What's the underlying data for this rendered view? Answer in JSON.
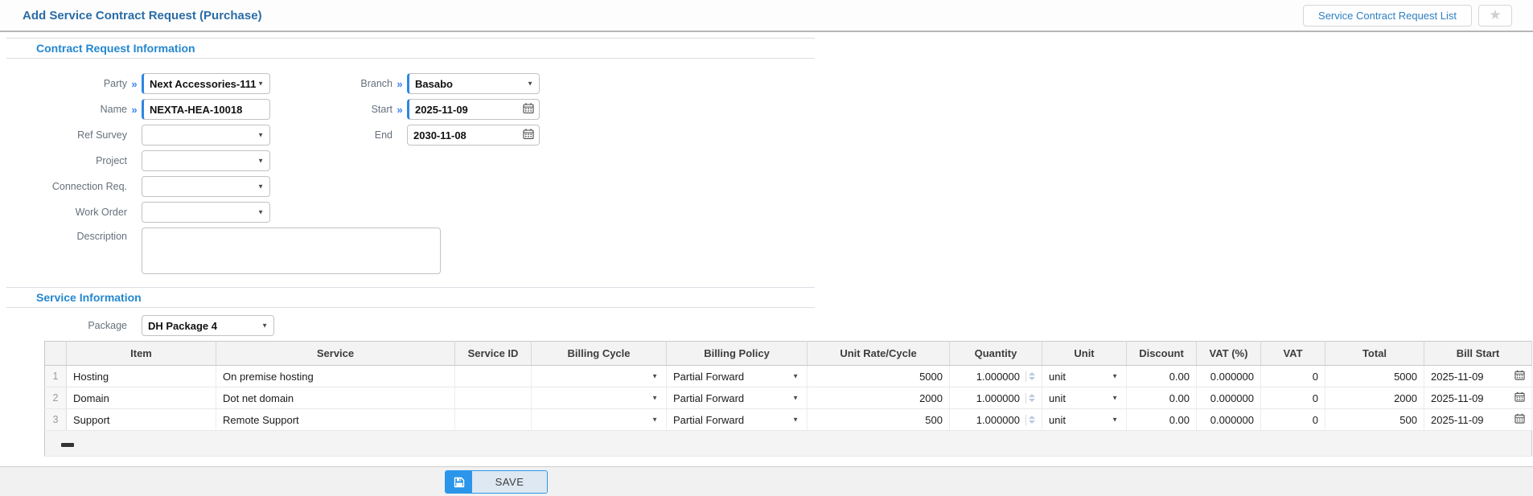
{
  "header": {
    "title": "Add Service Contract Request (Purchase)",
    "list_button_label": "Service Contract Request List"
  },
  "icons": {
    "caret": "▼",
    "required_marker": "»",
    "star": "★"
  },
  "contract_section": {
    "title": "Contract Request Information",
    "fields": {
      "party": {
        "label": "Party",
        "value": "Next Accessories-111"
      },
      "name": {
        "label": "Name",
        "value": "NEXTA-HEA-10018"
      },
      "ref_survey": {
        "label": "Ref Survey",
        "value": ""
      },
      "project": {
        "label": "Project",
        "value": ""
      },
      "connection_req": {
        "label": "Connection Req.",
        "value": ""
      },
      "work_order": {
        "label": "Work Order",
        "value": ""
      },
      "description": {
        "label": "Description",
        "value": ""
      },
      "branch": {
        "label": "Branch",
        "value": "Basabo"
      },
      "start": {
        "label": "Start",
        "value": "2025-11-09"
      },
      "end": {
        "label": "End",
        "value": "2030-11-08"
      }
    }
  },
  "service_section": {
    "title": "Service Information",
    "package": {
      "label": "Package",
      "value": "DH Package 4"
    }
  },
  "table": {
    "columns": [
      "",
      "Item",
      "Service",
      "Service ID",
      "Billing Cycle",
      "Billing Policy",
      "Unit Rate/Cycle",
      "Quantity",
      "Unit",
      "Discount",
      "VAT (%)",
      "VAT",
      "Total",
      "Bill Start"
    ],
    "rows": [
      {
        "no": "1",
        "item": "Hosting",
        "service": "On premise hosting",
        "service_id": "",
        "billing_cycle": "",
        "billing_policy": "Partial Forward",
        "unit_rate": "5000",
        "quantity": "1.000000",
        "unit": "unit",
        "discount": "0.00",
        "vat_pct": "0.000000",
        "vat": "0",
        "total": "5000",
        "bill_start": "2025-11-09"
      },
      {
        "no": "2",
        "item": "Domain",
        "service": "Dot net domain",
        "service_id": "",
        "billing_cycle": "",
        "billing_policy": "Partial Forward",
        "unit_rate": "2000",
        "quantity": "1.000000",
        "unit": "unit",
        "discount": "0.00",
        "vat_pct": "0.000000",
        "vat": "0",
        "total": "2000",
        "bill_start": "2025-11-09"
      },
      {
        "no": "3",
        "item": "Support",
        "service": "Remote Support",
        "service_id": "",
        "billing_cycle": "",
        "billing_policy": "Partial Forward",
        "unit_rate": "500",
        "quantity": "1.000000",
        "unit": "unit",
        "discount": "0.00",
        "vat_pct": "0.000000",
        "vat": "0",
        "total": "500",
        "bill_start": "2025-11-09"
      }
    ]
  },
  "footer": {
    "save_label": "SAVE"
  }
}
